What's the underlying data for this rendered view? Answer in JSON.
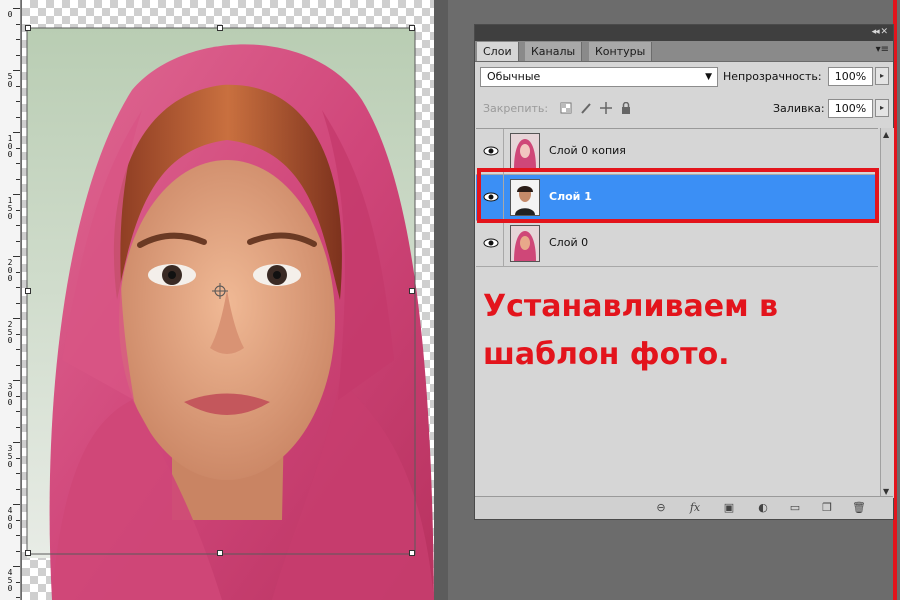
{
  "canvas": {
    "ruler_labels": [
      "0",
      "50",
      "100",
      "150",
      "200",
      "250",
      "300",
      "350",
      "400",
      "450"
    ],
    "image": "photo-of-woman-in-pink-headscarf"
  },
  "layers_panel": {
    "tabs": [
      {
        "label": "Слои",
        "active": true
      },
      {
        "label": "Каналы",
        "active": false
      },
      {
        "label": "Контуры",
        "active": false
      }
    ],
    "blend_mode": "Обычные",
    "opacity_label": "Непрозрачность:",
    "opacity_value": "100%",
    "lock_label": "Закрепить:",
    "fill_label": "Заливка:",
    "fill_value": "100%",
    "layers": [
      {
        "name": "Слой 0 копия",
        "selected": false,
        "visible": true
      },
      {
        "name": "Слой 1",
        "selected": true,
        "visible": true
      },
      {
        "name": "Слой 0",
        "selected": false,
        "visible": true
      }
    ],
    "footer_icons": [
      "link-icon",
      "fx-icon",
      "mask-icon",
      "adjustment-icon",
      "group-folder-icon",
      "new-layer-icon",
      "trash-icon"
    ]
  },
  "annotation": {
    "line1": "Устанавливаем в",
    "line2": "шаблон фото."
  },
  "colors": {
    "highlight_red": "#e3141c",
    "selection_blue": "#3b8ff5",
    "headscarf_pink": "#d64a7a"
  }
}
